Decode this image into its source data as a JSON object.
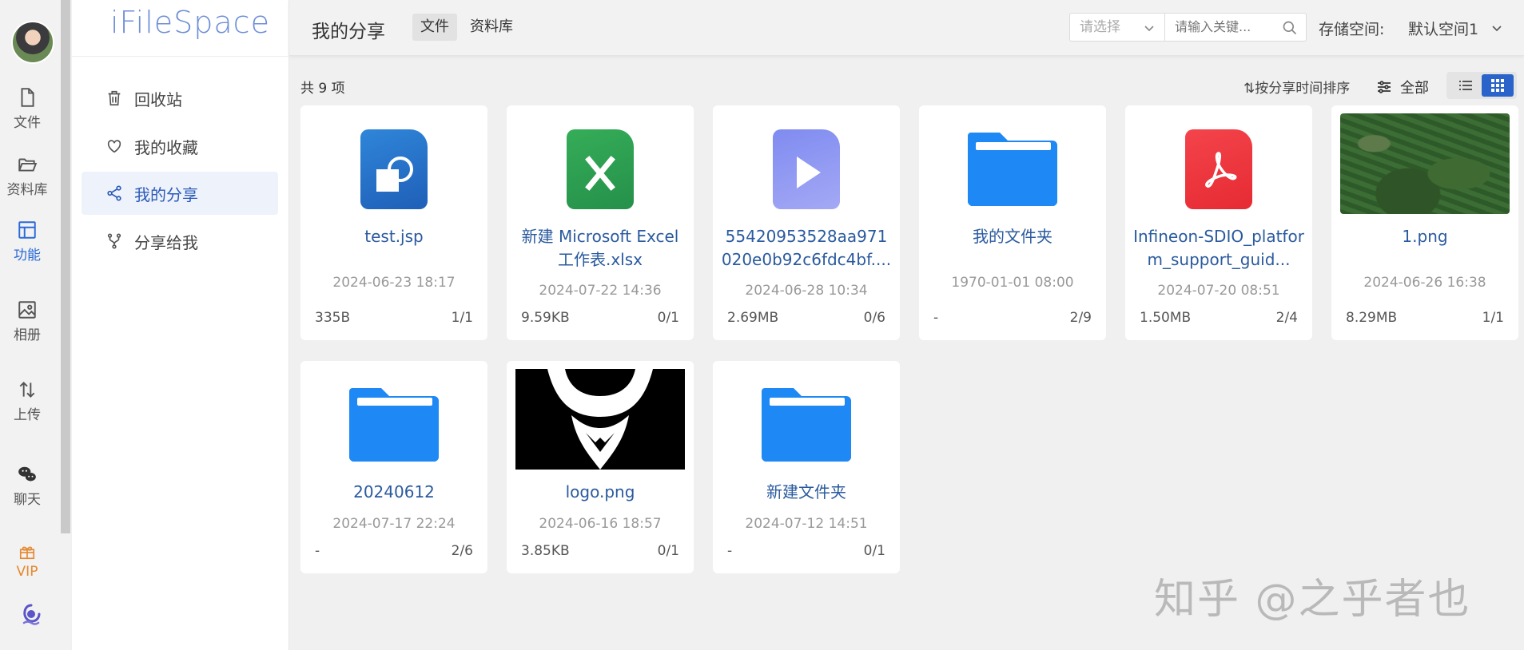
{
  "app": {
    "name": "iFileSpace"
  },
  "rail": {
    "items": [
      {
        "label": "文件",
        "icon": "file-icon"
      },
      {
        "label": "资料库",
        "icon": "folder-open-icon"
      },
      {
        "label": "功能",
        "icon": "layout-icon"
      },
      {
        "label": "相册",
        "icon": "image-icon"
      },
      {
        "label": "上传",
        "icon": "transfer-icon"
      },
      {
        "label": "聊天",
        "icon": "wechat-icon"
      },
      {
        "label": "VIP",
        "icon": "gift-icon"
      }
    ],
    "active": "功能"
  },
  "sidebar": {
    "items": [
      {
        "label": "回收站",
        "icon": "trash-icon"
      },
      {
        "label": "我的收藏",
        "icon": "heart-icon"
      },
      {
        "label": "我的分享",
        "icon": "share-icon"
      },
      {
        "label": "分享给我",
        "icon": "fork-icon"
      }
    ],
    "active": "我的分享"
  },
  "header": {
    "title": "我的分享",
    "tabs": [
      {
        "label": "文件"
      },
      {
        "label": "资料库"
      }
    ],
    "active_tab": "文件",
    "select_placeholder": "请选择",
    "search_placeholder": "请输入关键...",
    "storage_label": "存储空间:",
    "storage_value": "默认空间1"
  },
  "toolbar": {
    "count": "共 9 项",
    "sort_label": "⇅按分享时间排序",
    "filter_label": "全部"
  },
  "files": [
    {
      "name": "test.jsp",
      "date": "2024-06-23 18:17",
      "size": "335B",
      "ratio": "1/1",
      "kind": "jsp"
    },
    {
      "name": "新建 Microsoft Excel 工作表.xlsx",
      "date": "2024-07-22 14:36",
      "size": "9.59KB",
      "ratio": "0/1",
      "kind": "excel"
    },
    {
      "name": "55420953528aa971020e0b92c6fdc4bf....",
      "date": "2024-06-28 10:34",
      "size": "2.69MB",
      "ratio": "0/6",
      "kind": "video"
    },
    {
      "name": "我的文件夹",
      "date": "1970-01-01 08:00",
      "size": "-",
      "ratio": "2/9",
      "kind": "folder"
    },
    {
      "name": "Infineon-SDIO_platform_support_guid...",
      "date": "2024-07-20 08:51",
      "size": "1.50MB",
      "ratio": "2/4",
      "kind": "pdf"
    },
    {
      "name": "1.png",
      "date": "2024-06-26 16:38",
      "size": "8.29MB",
      "ratio": "1/1",
      "kind": "photo"
    },
    {
      "name": "20240612",
      "date": "2024-07-17 22:24",
      "size": "-",
      "ratio": "2/6",
      "kind": "folder"
    },
    {
      "name": "logo.png",
      "date": "2024-06-16 18:57",
      "size": "3.85KB",
      "ratio": "0/1",
      "kind": "logo"
    },
    {
      "name": "新建文件夹",
      "date": "2024-07-12 14:51",
      "size": "-",
      "ratio": "0/1",
      "kind": "folder"
    }
  ],
  "colors": {
    "accent": "#2a63c9",
    "folder": "#1e88f5",
    "excel": "#2ea34f",
    "pdf": "#f0363f",
    "video": "#8c94f2",
    "jsp": "#2f7fd0"
  },
  "watermark": "知乎 @之乎者也"
}
